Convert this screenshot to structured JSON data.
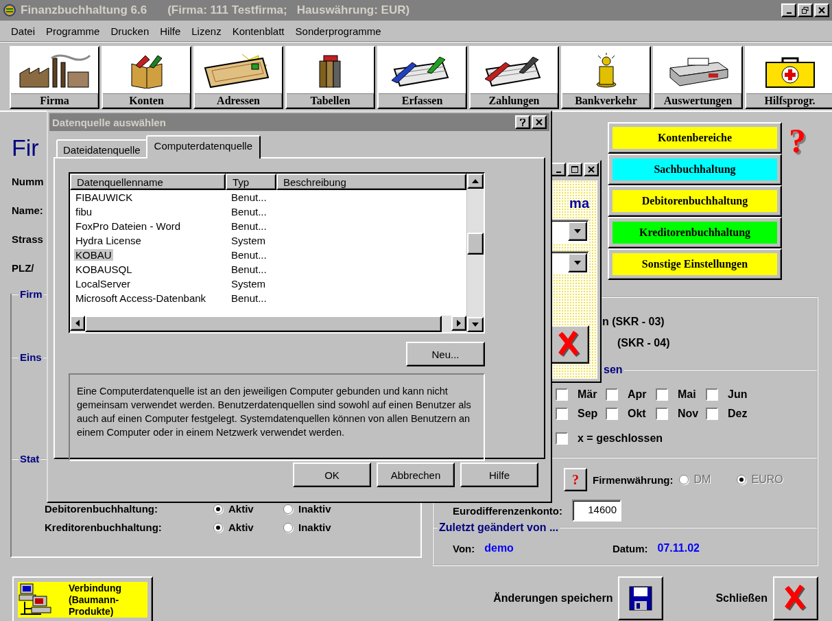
{
  "window": {
    "title": "Finanzbuchhaltung 6.6",
    "subtitle": "(Firma: 111 Testfirma;   Hauswährung: EUR)"
  },
  "menu": [
    "Datei",
    "Programme",
    "Drucken",
    "Hilfe",
    "Lizenz",
    "Kontenblatt",
    "Sonderprogramme"
  ],
  "toolbar": [
    "Firma",
    "Konten",
    "Adressen",
    "Tabellen",
    "Erfassen",
    "Zahlungen",
    "Bankverkehr",
    "Auswertungen",
    "Hilfsprogr."
  ],
  "form": {
    "heading": "Fir",
    "fields": [
      "Numm",
      "Name:",
      "Strass",
      "PLZ/"
    ],
    "groups": [
      "Firm",
      "Eins",
      "Stat"
    ],
    "status_rows": [
      {
        "label": "Debitorenbuchhaltung:",
        "options": [
          {
            "label": "Aktiv",
            "selected": true
          },
          {
            "label": "Inaktiv",
            "selected": false
          }
        ]
      },
      {
        "label": "Kreditorenbuchhaltung:",
        "options": [
          {
            "label": "Aktiv",
            "selected": true
          },
          {
            "label": "Inaktiv",
            "selected": false
          }
        ]
      }
    ]
  },
  "section_buttons": [
    {
      "label": "Kontenbereiche",
      "color": "#ffff00"
    },
    {
      "label": "Sachbuchhaltung",
      "color": "#00ffff"
    },
    {
      "label": "Debitorenbuchhaltung",
      "color": "#ffff00"
    },
    {
      "label": "Kreditorenbuchhaltung",
      "color": "#00ff00"
    },
    {
      "label": "Sonstige Einstellungen",
      "color": "#ffff00"
    }
  ],
  "help_mark": "?",
  "settings": {
    "chart_lines": [
      "n (SKR - 03)",
      "(SKR - 04)"
    ],
    "months_group": "sen",
    "months": [
      {
        "label": "Mär",
        "checked": false
      },
      {
        "label": "Apr",
        "checked": false
      },
      {
        "label": "Mai",
        "checked": false
      },
      {
        "label": "Jun",
        "checked": false
      },
      {
        "label": "Sep",
        "checked": false
      },
      {
        "label": "Okt",
        "checked": false
      },
      {
        "label": "Nov",
        "checked": false
      },
      {
        "label": "Dez",
        "checked": false
      }
    ],
    "legend": {
      "label": "x = geschlossen",
      "checked": false
    },
    "help_button": "?",
    "currency_label": "Firmenwährung:",
    "currency_disabled": true,
    "currency_options": [
      {
        "label": "DM",
        "selected": false
      },
      {
        "label": "EURO",
        "selected": true
      }
    ],
    "euro_account_label": "Eurodifferenzenkonto:",
    "euro_account": "14600",
    "changed_group": "Zuletzt geändert von ...",
    "changed_by_label": "Von:",
    "changed_by": "demo",
    "date_label": "Datum:",
    "date": "07.11.02"
  },
  "inner_window": {
    "heading": "ma"
  },
  "dialog": {
    "title": "Datenquelle auswählen",
    "tabs": [
      {
        "label": "Dateidatenquelle",
        "selected": false
      },
      {
        "label": "Computerdatenquelle",
        "selected": true
      }
    ],
    "columns": [
      "Datenquellenname",
      "Typ",
      "Beschreibung"
    ],
    "rows": [
      {
        "name": "FIBAUWICK",
        "type": "Benut...",
        "selected": false
      },
      {
        "name": "fibu",
        "type": "Benut...",
        "selected": false
      },
      {
        "name": "FoxPro Dateien - Word",
        "type": "Benut...",
        "selected": false
      },
      {
        "name": "Hydra License",
        "type": "System",
        "selected": false
      },
      {
        "name": "KOBAU",
        "type": "Benut...",
        "selected": true
      },
      {
        "name": "KOBAUSQL",
        "type": "Benut...",
        "selected": false
      },
      {
        "name": "LocalServer",
        "type": "System",
        "selected": false
      },
      {
        "name": "Microsoft Access-Datenbank",
        "type": "Benut...",
        "selected": false
      }
    ],
    "new_button": "Neu...",
    "description": "Eine Computerdatenquelle ist an den jeweiligen Computer gebunden und kann nicht gemeinsam verwendet werden. Benutzerdatenquellen sind sowohl auf einen Benutzer als auch auf einen Computer festgelegt. Systemdatenquellen können von allen Benutzern an einem Computer oder in einem Netzwerk verwendet werden.",
    "buttons": [
      "OK",
      "Abbrechen",
      "Hilfe"
    ]
  },
  "bottom": {
    "connection_lines": [
      "Verbindung",
      "(Baumann-",
      "Produkte)"
    ],
    "save_label": "Änderungen speichern",
    "close_label": "Schließen"
  }
}
